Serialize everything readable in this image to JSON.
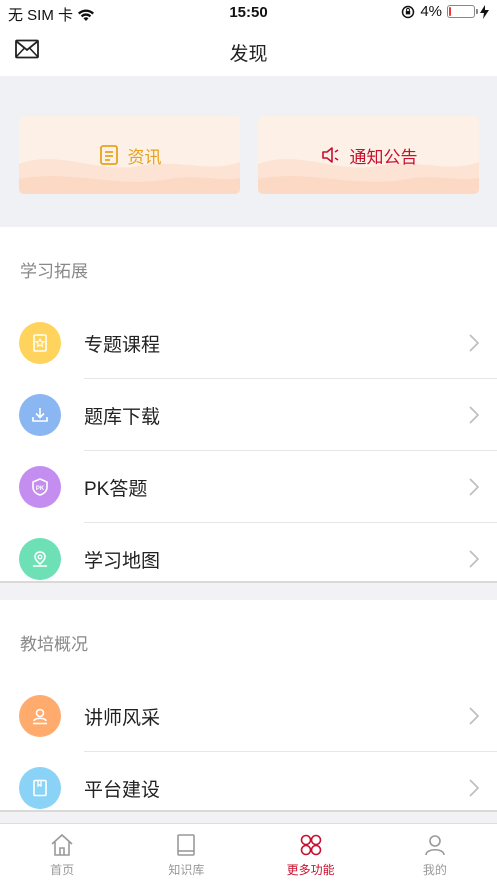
{
  "status": {
    "carrier": "无 SIM 卡",
    "time": "15:50",
    "battery": "4%"
  },
  "header": {
    "title": "发现"
  },
  "banners": {
    "news": "资讯",
    "notice": "通知公告"
  },
  "study": {
    "title": "学习拓展",
    "items": [
      {
        "label": "专题课程",
        "color": "#ffd35c"
      },
      {
        "label": "题库下载",
        "color": "#8ab6f2"
      },
      {
        "label": "PK答题",
        "color": "#c48ef0"
      },
      {
        "label": "学习地图",
        "color": "#6de0b6"
      }
    ]
  },
  "overview": {
    "title": "教培概况",
    "items": [
      {
        "label": "讲师风采",
        "color": "#ffab6e"
      },
      {
        "label": "平台建设",
        "color": "#8ad3f7"
      }
    ]
  },
  "tabs": [
    {
      "label": "首页"
    },
    {
      "label": "知识库"
    },
    {
      "label": "更多功能"
    },
    {
      "label": "我的"
    }
  ],
  "accent": "#c8102e"
}
